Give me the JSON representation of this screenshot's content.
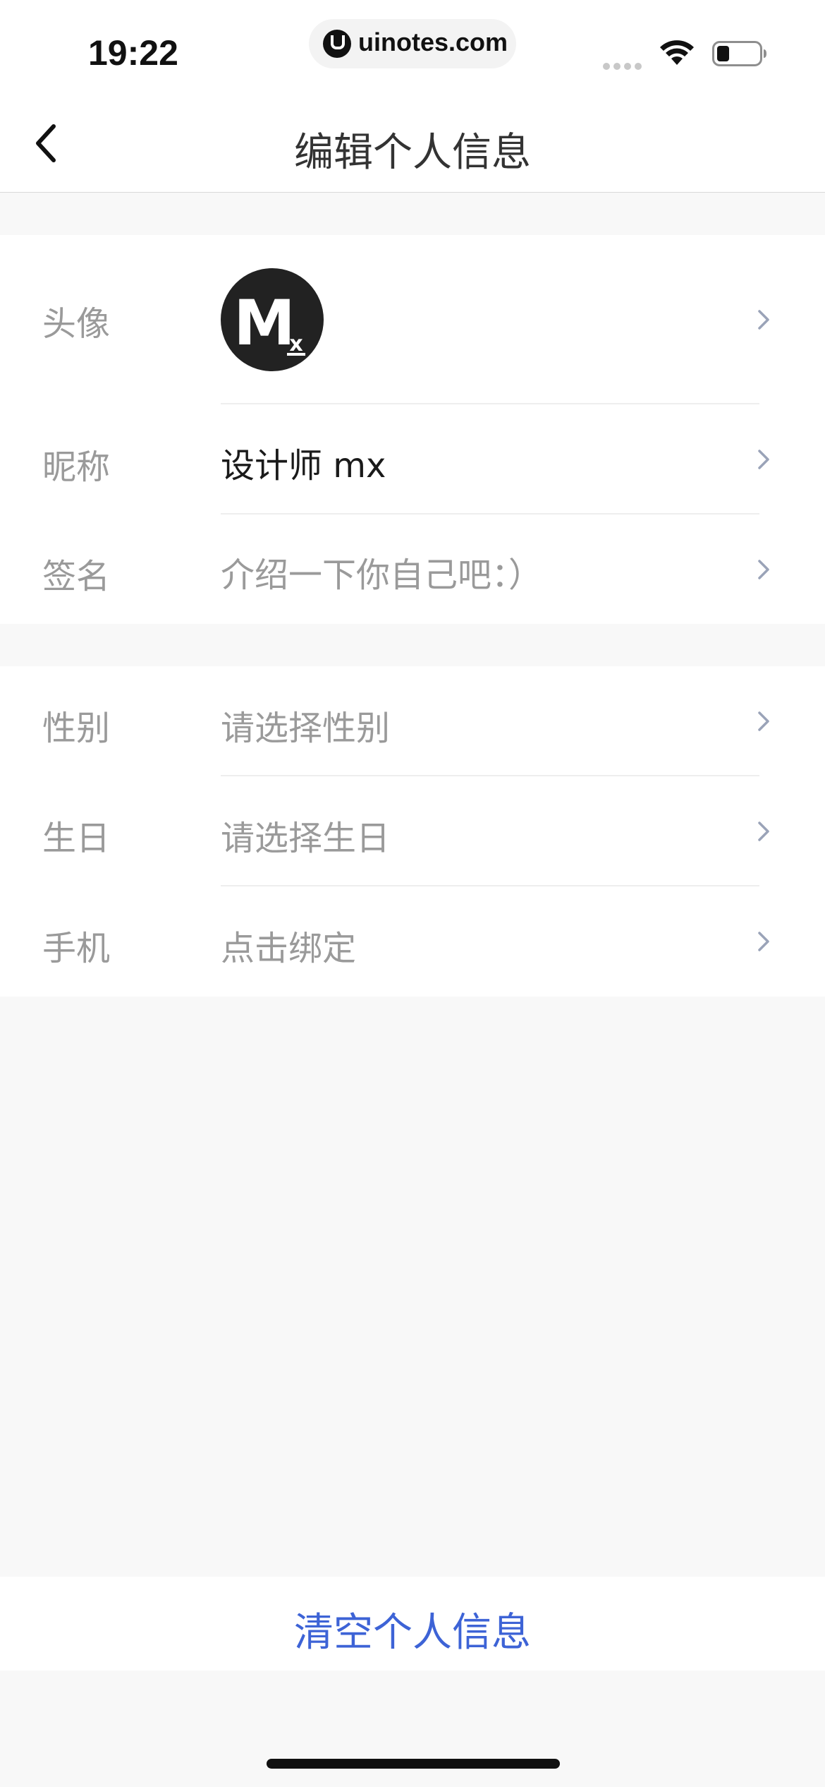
{
  "status_bar": {
    "time": "19:22",
    "url": "uinotes.com",
    "icons": [
      "signal-icon",
      "wifi-icon",
      "battery-icon"
    ]
  },
  "nav": {
    "title": "编辑个人信息",
    "back_icon": "chevron-left-icon"
  },
  "profile": {
    "avatar_label": "头像",
    "avatar_text": "M",
    "avatar_subtext": "x",
    "nickname_label": "昵称",
    "nickname_value": "设计师 mx",
    "signature_label": "签名",
    "signature_placeholder": "介绍一下你自己吧：）"
  },
  "details": {
    "gender_label": "性别",
    "gender_placeholder": "请选择性别",
    "birthday_label": "生日",
    "birthday_placeholder": "请选择生日",
    "phone_label": "手机",
    "phone_placeholder": "点击绑定"
  },
  "actions": {
    "clear_label": "清空个人信息"
  },
  "colors": {
    "accent": "#3d63d6",
    "label": "#9a9a9a",
    "value": "#1a1a1a",
    "background": "#f8f8f8",
    "chevron": "#9aa3b8"
  }
}
